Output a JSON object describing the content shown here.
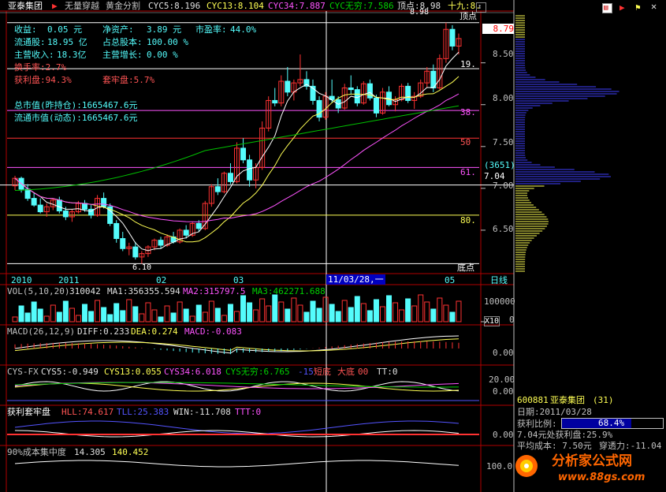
{
  "colors": {
    "bg": "#000000",
    "up": "#ff3232",
    "down": "#54fcfc",
    "ma5": "#ffffff",
    "ma13": "#ffff54",
    "ma34": "#ff54ff",
    "mawx": "#00c000",
    "grid": "#b00000",
    "fib": "#ff54ff",
    "text_cyan": "#54fcfc",
    "text_red": "#ff5454",
    "text_yellow": "#ffff54",
    "text_white": "#e0e0e0"
  },
  "header": {
    "stock": "亚泰集团",
    "formula": "无量穿越",
    "formula2": "黄金分割",
    "cyc5": "CYC5:8.196",
    "cyc13": "CYC13:8.104",
    "cyc34": "CYC34:7.887",
    "cycwx": "CYC无穷:7.586",
    "top_label": "顶点:8.98",
    "ninth": "十九:8."
  },
  "info": {
    "income_label": "收益:",
    "income": "0.05 元",
    "netasset_label": "净资产:",
    "netasset": "3.89 元",
    "pe_label": "市盈率:",
    "pe": "44.0%",
    "float_label": "流通股:",
    "float": "18.95 亿",
    "total_label": "占总股本:",
    "total": "100.00 %",
    "rev_label": "主营收入:",
    "rev": "18.3亿",
    "growth_label": "主营增长:",
    "growth": "0.00 %",
    "turnover": "换手率:2.7%",
    "profit": "获利盘:94.3%",
    "trapped": "套牢盘:5.7%",
    "mcap": "总市值(昨持仓):1665467.6元",
    "fmcap": "流通市值(动态):1665467.6元"
  },
  "price_axis": [
    "8.50",
    "8.00",
    "7.50",
    "7.00",
    "6.50"
  ],
  "current_price": "8.79",
  "selected_price": "7.04",
  "selected_count": "(3651)",
  "fib_labels": [
    "19.",
    "38.",
    "50",
    "61.",
    "80."
  ],
  "top_marker": "顶点",
  "bottom_marker": "底点",
  "top_value": "8.98",
  "bottom_value": "6.10",
  "date_axis": [
    "2010",
    "2011",
    "02",
    "03",
    "11/03/28,一",
    "05"
  ],
  "period": "日线",
  "vol": {
    "label": "VOL(5,10,20)",
    "v": "310042",
    "ma1": "MA1:356355.594",
    "ma2": "MA2:315797.5",
    "ma3": "MA3:462271.688",
    "axis": "100000",
    "axis0": "0",
    "unit": "X10"
  },
  "macd": {
    "label": "MACD(26,12,9)",
    "diff": "DIFF:0.233",
    "dea": "DEA:0.274",
    "macd": "MACD:-0.083",
    "axis": "0.00"
  },
  "cys": {
    "label": "CYS-FX",
    "c5": "CYS5:-0.949",
    "c13": "CYS13:0.055",
    "c34": "CYS34:6.018",
    "cwx": "CYS无穷:6.765",
    "n": "-15",
    "short": "短底",
    "big": "大底",
    "big_v": "00",
    "tt": "TT:0",
    "axis1": "20.00",
    "axis2": "0.00"
  },
  "profit_ind": {
    "label": "获利套牢盘",
    "hll": "HLL:74.617",
    "tll": "TLL:25.383",
    "win": "WIN:-11.708",
    "ttt": "TTT:0",
    "axis": "0.00"
  },
  "conc": {
    "label": "90%成本集中度",
    "a": "14.305",
    "b": "140.452",
    "axis": "100.0"
  },
  "panel": {
    "code": "600881",
    "name": "亚泰集团",
    "count": "(31)",
    "date": "日期:2011/03/28",
    "ratio_label": "获利比例:",
    "ratio": "68.4%",
    "line3": "7.04元处获利盘:25.9%",
    "line4a": "平均成本: 7.50元",
    "line4b": "穿透力:-11.04"
  },
  "watermark": {
    "brand": "分析家公式网",
    "url": "www.88gs.com"
  },
  "chart_data": {
    "type": "candlestick",
    "title": "亚泰集团",
    "ylim": [
      6.0,
      9.1
    ],
    "yticks": [
      8.5,
      8.0,
      7.5,
      7.0,
      6.5
    ],
    "candles": [
      [
        7.03,
        7.15,
        6.98,
        7.12
      ],
      [
        7.12,
        7.14,
        6.95,
        6.99
      ],
      [
        6.99,
        7.05,
        6.85,
        6.88
      ],
      [
        6.88,
        6.95,
        6.78,
        6.8
      ],
      [
        6.8,
        6.88,
        6.7,
        6.72
      ],
      [
        6.72,
        6.82,
        6.66,
        6.78
      ],
      [
        6.78,
        6.88,
        6.74,
        6.86
      ],
      [
        6.86,
        6.9,
        6.7,
        6.73
      ],
      [
        6.73,
        6.78,
        6.62,
        6.66
      ],
      [
        6.66,
        6.75,
        6.6,
        6.72
      ],
      [
        6.72,
        6.85,
        6.7,
        6.82
      ],
      [
        6.82,
        6.86,
        6.72,
        6.75
      ],
      [
        6.75,
        6.8,
        6.64,
        6.68
      ],
      [
        6.68,
        6.92,
        6.66,
        6.88
      ],
      [
        6.88,
        6.95,
        6.76,
        6.78
      ],
      [
        6.78,
        6.82,
        6.55,
        6.58
      ],
      [
        6.58,
        6.62,
        6.35,
        6.4
      ],
      [
        6.4,
        6.48,
        6.25,
        6.28
      ],
      [
        6.28,
        6.35,
        6.2,
        6.3
      ],
      [
        6.3,
        6.36,
        6.15,
        6.18
      ],
      [
        6.18,
        6.25,
        6.1,
        6.22
      ],
      [
        6.22,
        6.32,
        6.18,
        6.3
      ],
      [
        6.3,
        6.4,
        6.26,
        6.38
      ],
      [
        6.38,
        6.42,
        6.28,
        6.32
      ],
      [
        6.32,
        6.45,
        6.3,
        6.42
      ],
      [
        6.42,
        6.48,
        6.34,
        6.36
      ],
      [
        6.36,
        6.52,
        6.34,
        6.5
      ],
      [
        6.5,
        6.56,
        6.4,
        6.44
      ],
      [
        6.44,
        6.6,
        6.42,
        6.58
      ],
      [
        6.58,
        6.62,
        6.48,
        6.52
      ],
      [
        6.52,
        6.85,
        6.5,
        6.82
      ],
      [
        6.82,
        7.05,
        6.78,
        7.02
      ],
      [
        7.02,
        7.12,
        6.92,
        6.96
      ],
      [
        6.96,
        7.2,
        6.94,
        7.18
      ],
      [
        7.18,
        7.3,
        7.05,
        7.08
      ],
      [
        7.08,
        7.55,
        7.06,
        7.48
      ],
      [
        7.48,
        7.6,
        7.3,
        7.34
      ],
      [
        7.34,
        7.4,
        7.02,
        7.1
      ],
      [
        7.1,
        7.3,
        7.0,
        7.25
      ],
      [
        7.25,
        7.8,
        7.22,
        7.72
      ],
      [
        7.72,
        8.1,
        7.68,
        8.05
      ],
      [
        8.05,
        8.2,
        7.98,
        8.02
      ],
      [
        8.02,
        8.35,
        7.98,
        8.28
      ],
      [
        8.28,
        8.45,
        8.1,
        8.15
      ],
      [
        8.15,
        8.3,
        8.05,
        8.26
      ],
      [
        8.26,
        8.6,
        8.22,
        8.3
      ],
      [
        8.3,
        8.4,
        8.18,
        8.22
      ],
      [
        8.22,
        8.3,
        8.0,
        8.05
      ],
      [
        8.05,
        8.1,
        7.8,
        7.85
      ],
      [
        7.85,
        8.15,
        7.82,
        8.1
      ],
      [
        8.1,
        8.3,
        8.02,
        8.06
      ],
      [
        8.06,
        8.1,
        7.9,
        7.96
      ],
      [
        7.96,
        8.25,
        7.94,
        8.2
      ],
      [
        8.2,
        8.35,
        8.12,
        8.18
      ],
      [
        8.18,
        8.22,
        7.98,
        8.02
      ],
      [
        8.02,
        8.28,
        8.0,
        8.25
      ],
      [
        8.25,
        8.3,
        8.05,
        8.08
      ],
      [
        8.08,
        8.12,
        7.85,
        7.9
      ],
      [
        7.9,
        8.2,
        7.88,
        8.15
      ],
      [
        8.15,
        8.22,
        7.98,
        8.0
      ],
      [
        8.0,
        8.1,
        7.92,
        8.06
      ],
      [
        8.06,
        8.25,
        8.04,
        8.22
      ],
      [
        8.22,
        8.26,
        8.02,
        8.05
      ],
      [
        8.05,
        8.15,
        7.95,
        8.1
      ],
      [
        8.1,
        8.3,
        8.08,
        8.26
      ],
      [
        8.26,
        8.45,
        8.2,
        8.4
      ],
      [
        8.4,
        8.48,
        8.15,
        8.2
      ],
      [
        8.2,
        8.6,
        8.18,
        8.55
      ],
      [
        8.55,
        8.98,
        8.5,
        8.9
      ],
      [
        8.9,
        8.95,
        8.65,
        8.7
      ],
      [
        8.7,
        8.85,
        8.6,
        8.79
      ]
    ]
  }
}
